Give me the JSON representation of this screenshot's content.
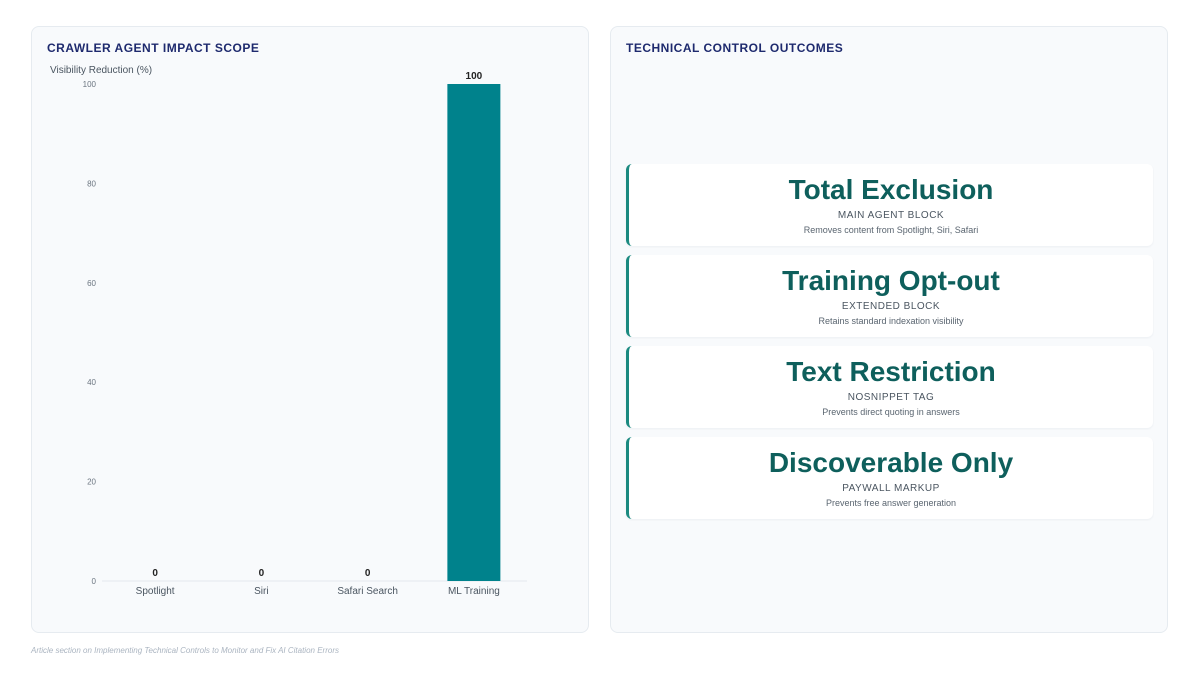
{
  "left_panel": {
    "title": "CRAWLER AGENT IMPACT SCOPE"
  },
  "right_panel": {
    "title": "TECHNICAL CONTROL OUTCOMES",
    "cards": [
      {
        "title": "Total Exclusion",
        "subtitle": "MAIN AGENT BLOCK",
        "description": "Removes content from Spotlight, Siri, Safari"
      },
      {
        "title": "Training Opt-out",
        "subtitle": "EXTENDED BLOCK",
        "description": "Retains standard indexation visibility"
      },
      {
        "title": "Text Restriction",
        "subtitle": "NOSNIPPET TAG",
        "description": "Prevents direct quoting in answers"
      },
      {
        "title": "Discoverable Only",
        "subtitle": "PAYWALL MARKUP",
        "description": "Prevents free answer generation"
      }
    ]
  },
  "footer": {
    "caption": "Article section on Implementing Technical Controls to Monitor and Fix AI Citation Errors"
  },
  "colors": {
    "bar": "#00828c",
    "accent": "#1b8a80",
    "title": "#1e2a6e",
    "card_title": "#0e5f5c"
  },
  "chart_data": {
    "type": "bar",
    "title": "CRAWLER AGENT IMPACT SCOPE",
    "xlabel": "",
    "ylabel": "Visibility Reduction (%)",
    "categories": [
      "Spotlight",
      "Siri",
      "Safari Search",
      "ML Training"
    ],
    "values": [
      0,
      0,
      0,
      100
    ],
    "data_labels": [
      "0",
      "0",
      "0",
      "100"
    ],
    "ylim": [
      0,
      100
    ],
    "yticks": [
      0,
      20,
      40,
      60,
      80,
      100
    ],
    "grid": false,
    "legend": "none"
  }
}
